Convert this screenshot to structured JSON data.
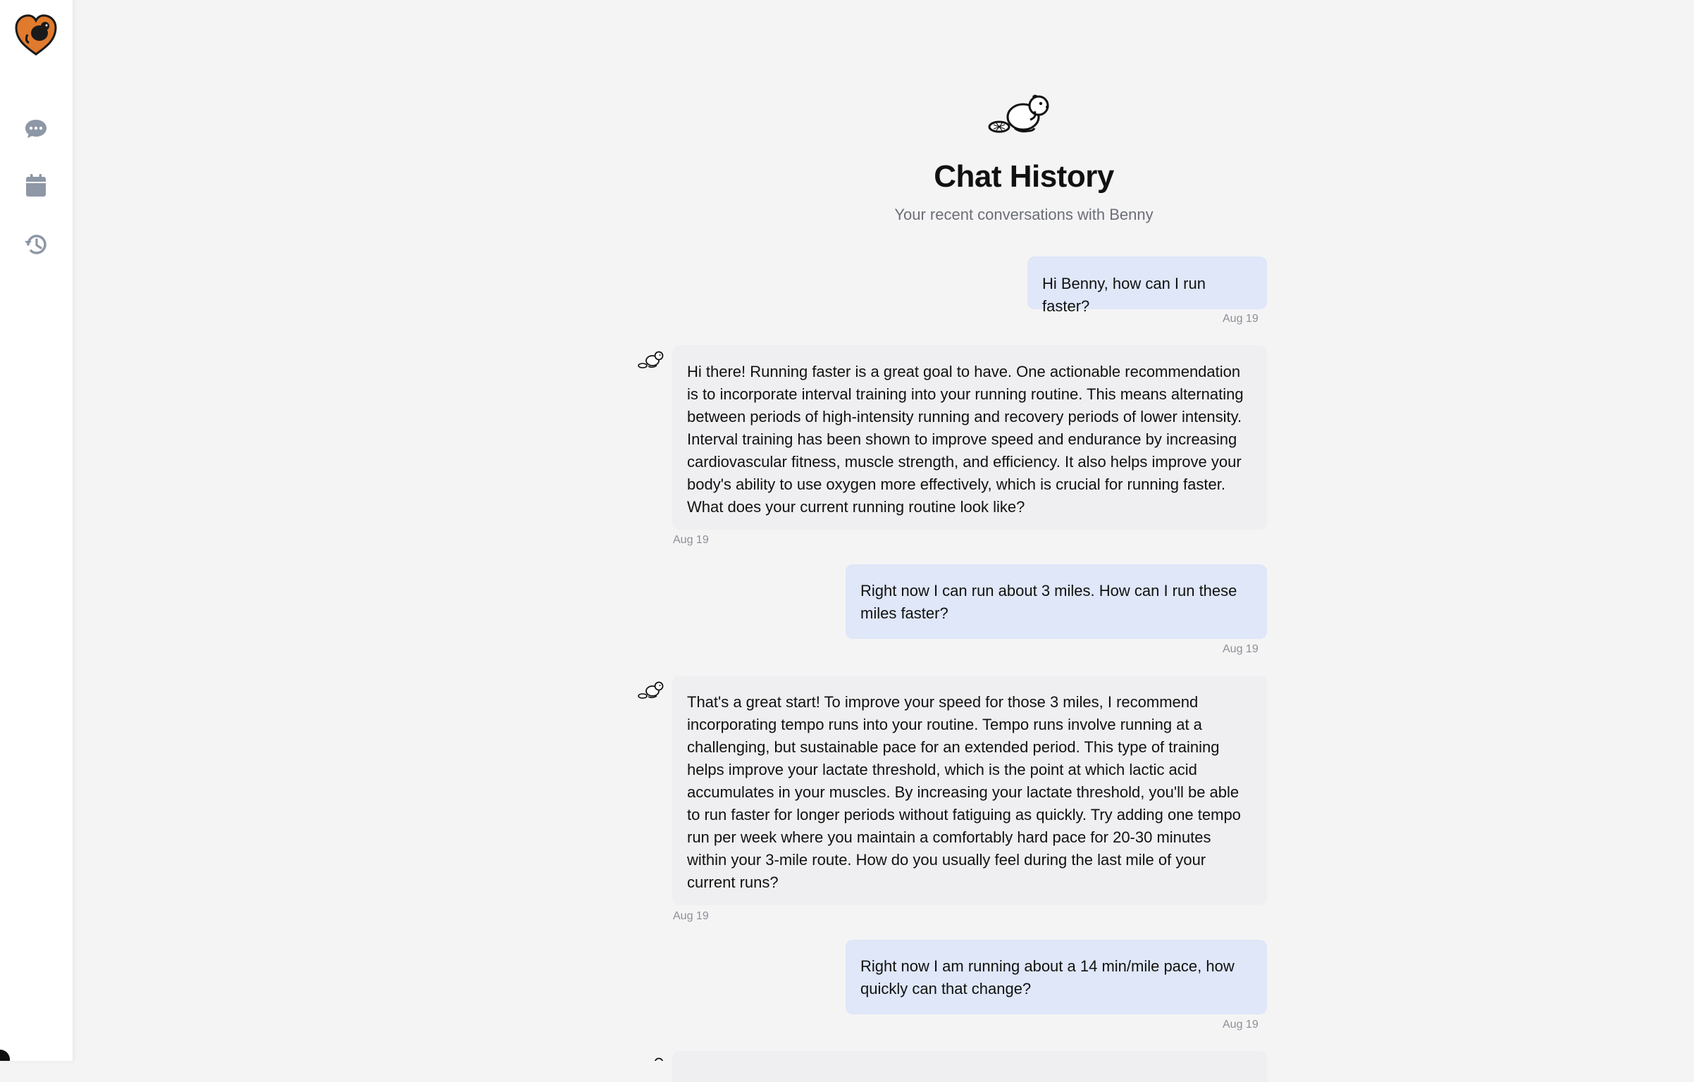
{
  "app": {
    "brand_color": "#e07a2d",
    "icons": [
      "beaver-heart-logo",
      "chat-bubble-icon",
      "calendar-icon",
      "history-icon",
      "beaver-icon"
    ]
  },
  "header": {
    "title": "Chat History",
    "subtitle": "Your recent conversations with Benny"
  },
  "messages": [
    {
      "role": "user",
      "text": "Hi Benny, how can I run faster?",
      "date": "Aug 19"
    },
    {
      "role": "assistant",
      "text": "Hi there! Running faster is a great goal to have. One actionable recommendation is to incorporate interval training into your running routine. This means alternating between periods of high-intensity running and recovery periods of lower intensity. Interval training has been shown to improve speed and endurance by increasing cardiovascular fitness, muscle strength, and efficiency. It also helps improve your body's ability to use oxygen more effectively, which is crucial for running faster. What does your current running routine look like?",
      "date": "Aug 19"
    },
    {
      "role": "user",
      "text": "Right now I can run about 3 miles. How can I run these miles faster?",
      "date": "Aug 19"
    },
    {
      "role": "assistant",
      "text": "That's a great start! To improve your speed for those 3 miles, I recommend incorporating tempo runs into your routine. Tempo runs involve running at a challenging, but sustainable pace for an extended period. This type of training helps improve your lactate threshold, which is the point at which lactic acid accumulates in your muscles. By increasing your lactate threshold, you'll be able to run faster for longer periods without fatiguing as quickly. Try adding one tempo run per week where you maintain a comfortably hard pace for 20-30 minutes within your 3-mile route. How do you usually feel during the last mile of your current runs?",
      "date": "Aug 19"
    },
    {
      "role": "user",
      "text": "Right now I am running about a 14 min/mile pace, how quickly can that change?",
      "date": "Aug 19"
    }
  ]
}
